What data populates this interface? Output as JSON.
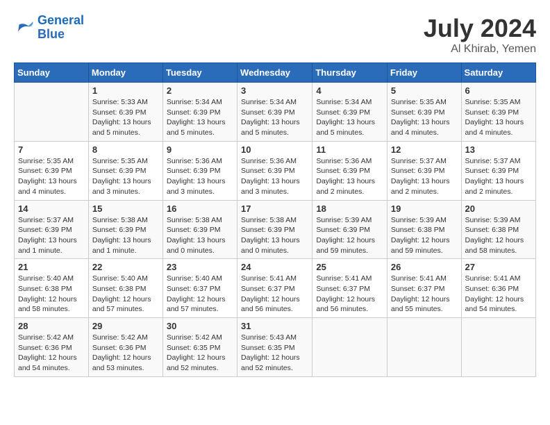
{
  "logo": {
    "line1": "General",
    "line2": "Blue"
  },
  "title": "July 2024",
  "location": "Al Khirab, Yemen",
  "columns": [
    "Sunday",
    "Monday",
    "Tuesday",
    "Wednesday",
    "Thursday",
    "Friday",
    "Saturday"
  ],
  "weeks": [
    [
      {
        "day": "",
        "info": ""
      },
      {
        "day": "1",
        "info": "Sunrise: 5:33 AM\nSunset: 6:39 PM\nDaylight: 13 hours and 5 minutes."
      },
      {
        "day": "2",
        "info": "Sunrise: 5:34 AM\nSunset: 6:39 PM\nDaylight: 13 hours and 5 minutes."
      },
      {
        "day": "3",
        "info": "Sunrise: 5:34 AM\nSunset: 6:39 PM\nDaylight: 13 hours and 5 minutes."
      },
      {
        "day": "4",
        "info": "Sunrise: 5:34 AM\nSunset: 6:39 PM\nDaylight: 13 hours and 5 minutes."
      },
      {
        "day": "5",
        "info": "Sunrise: 5:35 AM\nSunset: 6:39 PM\nDaylight: 13 hours and 4 minutes."
      },
      {
        "day": "6",
        "info": "Sunrise: 5:35 AM\nSunset: 6:39 PM\nDaylight: 13 hours and 4 minutes."
      }
    ],
    [
      {
        "day": "7",
        "info": "Sunrise: 5:35 AM\nSunset: 6:39 PM\nDaylight: 13 hours and 4 minutes."
      },
      {
        "day": "8",
        "info": "Sunrise: 5:35 AM\nSunset: 6:39 PM\nDaylight: 13 hours and 3 minutes."
      },
      {
        "day": "9",
        "info": "Sunrise: 5:36 AM\nSunset: 6:39 PM\nDaylight: 13 hours and 3 minutes."
      },
      {
        "day": "10",
        "info": "Sunrise: 5:36 AM\nSunset: 6:39 PM\nDaylight: 13 hours and 3 minutes."
      },
      {
        "day": "11",
        "info": "Sunrise: 5:36 AM\nSunset: 6:39 PM\nDaylight: 13 hours and 2 minutes."
      },
      {
        "day": "12",
        "info": "Sunrise: 5:37 AM\nSunset: 6:39 PM\nDaylight: 13 hours and 2 minutes."
      },
      {
        "day": "13",
        "info": "Sunrise: 5:37 AM\nSunset: 6:39 PM\nDaylight: 13 hours and 2 minutes."
      }
    ],
    [
      {
        "day": "14",
        "info": "Sunrise: 5:37 AM\nSunset: 6:39 PM\nDaylight: 13 hours and 1 minute."
      },
      {
        "day": "15",
        "info": "Sunrise: 5:38 AM\nSunset: 6:39 PM\nDaylight: 13 hours and 1 minute."
      },
      {
        "day": "16",
        "info": "Sunrise: 5:38 AM\nSunset: 6:39 PM\nDaylight: 13 hours and 0 minutes."
      },
      {
        "day": "17",
        "info": "Sunrise: 5:38 AM\nSunset: 6:39 PM\nDaylight: 13 hours and 0 minutes."
      },
      {
        "day": "18",
        "info": "Sunrise: 5:39 AM\nSunset: 6:39 PM\nDaylight: 12 hours and 59 minutes."
      },
      {
        "day": "19",
        "info": "Sunrise: 5:39 AM\nSunset: 6:38 PM\nDaylight: 12 hours and 59 minutes."
      },
      {
        "day": "20",
        "info": "Sunrise: 5:39 AM\nSunset: 6:38 PM\nDaylight: 12 hours and 58 minutes."
      }
    ],
    [
      {
        "day": "21",
        "info": "Sunrise: 5:40 AM\nSunset: 6:38 PM\nDaylight: 12 hours and 58 minutes."
      },
      {
        "day": "22",
        "info": "Sunrise: 5:40 AM\nSunset: 6:38 PM\nDaylight: 12 hours and 57 minutes."
      },
      {
        "day": "23",
        "info": "Sunrise: 5:40 AM\nSunset: 6:37 PM\nDaylight: 12 hours and 57 minutes."
      },
      {
        "day": "24",
        "info": "Sunrise: 5:41 AM\nSunset: 6:37 PM\nDaylight: 12 hours and 56 minutes."
      },
      {
        "day": "25",
        "info": "Sunrise: 5:41 AM\nSunset: 6:37 PM\nDaylight: 12 hours and 56 minutes."
      },
      {
        "day": "26",
        "info": "Sunrise: 5:41 AM\nSunset: 6:37 PM\nDaylight: 12 hours and 55 minutes."
      },
      {
        "day": "27",
        "info": "Sunrise: 5:41 AM\nSunset: 6:36 PM\nDaylight: 12 hours and 54 minutes."
      }
    ],
    [
      {
        "day": "28",
        "info": "Sunrise: 5:42 AM\nSunset: 6:36 PM\nDaylight: 12 hours and 54 minutes."
      },
      {
        "day": "29",
        "info": "Sunrise: 5:42 AM\nSunset: 6:36 PM\nDaylight: 12 hours and 53 minutes."
      },
      {
        "day": "30",
        "info": "Sunrise: 5:42 AM\nSunset: 6:35 PM\nDaylight: 12 hours and 52 minutes."
      },
      {
        "day": "31",
        "info": "Sunrise: 5:43 AM\nSunset: 6:35 PM\nDaylight: 12 hours and 52 minutes."
      },
      {
        "day": "",
        "info": ""
      },
      {
        "day": "",
        "info": ""
      },
      {
        "day": "",
        "info": ""
      }
    ]
  ]
}
